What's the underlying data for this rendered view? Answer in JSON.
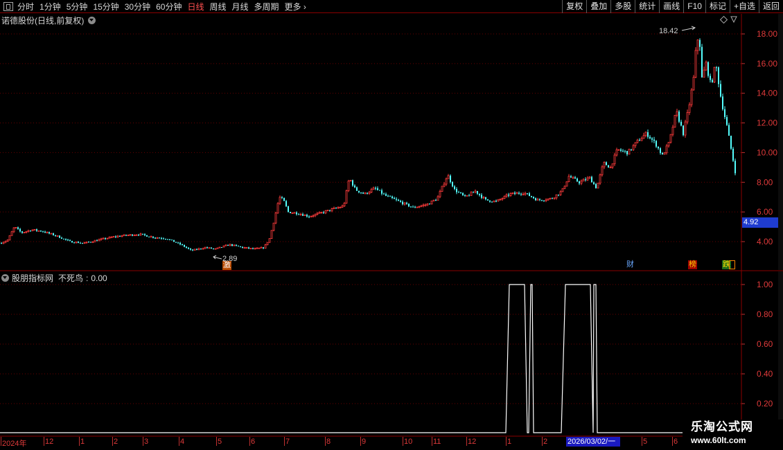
{
  "toolbar": {
    "periods": [
      "分时",
      "1分钟",
      "5分钟",
      "15分钟",
      "30分钟",
      "60分钟",
      "日线",
      "周线",
      "月线",
      "多周期",
      "更多"
    ],
    "active_period": "日线",
    "buttons": [
      "复权",
      "叠加",
      "多股",
      "统计",
      "画线",
      "F10",
      "标记",
      "+自选",
      "返回"
    ]
  },
  "main_chart": {
    "title": "诺德股份(日线,前复权)",
    "current_price": "4.92",
    "high_label": "18.42",
    "low_label": "2.89",
    "events": [
      "激",
      "财",
      "榜",
      "跌"
    ]
  },
  "indicator": {
    "title": "股朋指标网",
    "name": "不死鸟",
    "value": "0.00"
  },
  "x_axis": {
    "year_label": "2024年",
    "months": [
      "12",
      "1",
      "2",
      "3",
      "4",
      "5",
      "6",
      "7",
      "8",
      "9",
      "10",
      "11",
      "12",
      "1",
      "2",
      "5",
      "6"
    ],
    "cursor_date": "2026/03/02/一"
  },
  "watermark": {
    "title": "乐淘公式网",
    "url": "www.60lt.com"
  },
  "chart_data": [
    {
      "type": "candlestick",
      "title": "诺德股份(日线,前复权)",
      "y_ticks": [
        18.0,
        16.0,
        14.0,
        12.0,
        10.0,
        8.0,
        6.0,
        4.0
      ],
      "ylim": [
        2.5,
        19.2
      ],
      "grid": true,
      "x_month_labels": [
        "2024年",
        "12",
        "1",
        "2",
        "3",
        "4",
        "5",
        "6",
        "7",
        "8",
        "9",
        "10",
        "11",
        "12",
        "1",
        "2",
        "2026/03/02/一",
        "5",
        "6"
      ],
      "annotations": {
        "max": 18.42,
        "min": 2.89,
        "last": 4.92
      },
      "approx_close_path": [
        {
          "t": 0,
          "v": 3.9
        },
        {
          "t": 10,
          "v": 4.1
        },
        {
          "t": 20,
          "v": 5.0
        },
        {
          "t": 30,
          "v": 4.6
        },
        {
          "t": 45,
          "v": 4.8
        },
        {
          "t": 60,
          "v": 4.7
        },
        {
          "t": 80,
          "v": 4.4
        },
        {
          "t": 100,
          "v": 4.0
        },
        {
          "t": 120,
          "v": 3.9
        },
        {
          "t": 140,
          "v": 4.1
        },
        {
          "t": 160,
          "v": 4.3
        },
        {
          "t": 175,
          "v": 4.4
        },
        {
          "t": 200,
          "v": 4.5
        },
        {
          "t": 220,
          "v": 4.3
        },
        {
          "t": 240,
          "v": 4.2
        },
        {
          "t": 260,
          "v": 3.8
        },
        {
          "t": 275,
          "v": 3.4
        },
        {
          "t": 295,
          "v": 3.6
        },
        {
          "t": 310,
          "v": 3.5
        },
        {
          "t": 330,
          "v": 3.8
        },
        {
          "t": 350,
          "v": 3.6
        },
        {
          "t": 365,
          "v": 3.5
        },
        {
          "t": 380,
          "v": 3.6
        },
        {
          "t": 388,
          "v": 4.2
        },
        {
          "t": 395,
          "v": 5.5
        },
        {
          "t": 402,
          "v": 7.0
        },
        {
          "t": 408,
          "v": 6.8
        },
        {
          "t": 415,
          "v": 6.0
        },
        {
          "t": 430,
          "v": 5.9
        },
        {
          "t": 445,
          "v": 5.7
        },
        {
          "t": 460,
          "v": 5.9
        },
        {
          "t": 480,
          "v": 6.2
        },
        {
          "t": 495,
          "v": 6.4
        },
        {
          "t": 503,
          "v": 8.3
        },
        {
          "t": 512,
          "v": 7.5
        },
        {
          "t": 525,
          "v": 7.2
        },
        {
          "t": 540,
          "v": 7.6
        },
        {
          "t": 555,
          "v": 7.1
        },
        {
          "t": 575,
          "v": 6.7
        },
        {
          "t": 595,
          "v": 6.3
        },
        {
          "t": 615,
          "v": 6.5
        },
        {
          "t": 630,
          "v": 6.9
        },
        {
          "t": 645,
          "v": 8.5
        },
        {
          "t": 655,
          "v": 7.5
        },
        {
          "t": 670,
          "v": 7.0
        },
        {
          "t": 685,
          "v": 7.4
        },
        {
          "t": 700,
          "v": 6.8
        },
        {
          "t": 715,
          "v": 6.7
        },
        {
          "t": 735,
          "v": 7.2
        },
        {
          "t": 755,
          "v": 7.3
        },
        {
          "t": 775,
          "v": 6.8
        },
        {
          "t": 795,
          "v": 6.9
        },
        {
          "t": 810,
          "v": 7.4
        },
        {
          "t": 820,
          "v": 8.4
        },
        {
          "t": 835,
          "v": 8.0
        },
        {
          "t": 850,
          "v": 8.3
        },
        {
          "t": 860,
          "v": 7.6
        },
        {
          "t": 870,
          "v": 9.3
        },
        {
          "t": 880,
          "v": 9.0
        },
        {
          "t": 890,
          "v": 10.2
        },
        {
          "t": 905,
          "v": 10.0
        },
        {
          "t": 920,
          "v": 10.8
        },
        {
          "t": 932,
          "v": 11.3
        },
        {
          "t": 945,
          "v": 10.6
        },
        {
          "t": 955,
          "v": 9.8
        },
        {
          "t": 965,
          "v": 10.7
        },
        {
          "t": 975,
          "v": 12.8
        },
        {
          "t": 985,
          "v": 11.3
        },
        {
          "t": 993,
          "v": 13.0
        },
        {
          "t": 1000,
          "v": 15.0
        },
        {
          "t": 1004,
          "v": 17.3
        },
        {
          "t": 1008,
          "v": 18.0
        },
        {
          "t": 1012,
          "v": 15.0
        },
        {
          "t": 1018,
          "v": 16.0
        },
        {
          "t": 1025,
          "v": 14.5
        },
        {
          "t": 1032,
          "v": 16.0
        },
        {
          "t": 1040,
          "v": 13.5
        },
        {
          "t": 1048,
          "v": 11.8
        },
        {
          "t": 1055,
          "v": 10.0
        },
        {
          "t": 1062,
          "v": 8.2
        }
      ]
    },
    {
      "type": "line",
      "title": "不死鸟",
      "y_ticks": [
        1.0,
        0.8,
        0.6,
        0.4,
        0.2
      ],
      "ylim": [
        0.0,
        1.05
      ],
      "grid": true,
      "series": [
        {
          "name": "不死鸟",
          "points": [
            {
              "t": 0,
              "v": 0
            },
            {
              "t": 730,
              "v": 0
            },
            {
              "t": 735,
              "v": 1
            },
            {
              "t": 757,
              "v": 1
            },
            {
              "t": 761,
              "v": 0
            },
            {
              "t": 763,
              "v": 0
            },
            {
              "t": 766,
              "v": 1
            },
            {
              "t": 768,
              "v": 1
            },
            {
              "t": 770,
              "v": 0
            },
            {
              "t": 810,
              "v": 0
            },
            {
              "t": 816,
              "v": 1
            },
            {
              "t": 852,
              "v": 1
            },
            {
              "t": 856,
              "v": 0
            },
            {
              "t": 857,
              "v": 1
            },
            {
              "t": 860,
              "v": 1
            },
            {
              "t": 862,
              "v": 0
            },
            {
              "t": 1068,
              "v": 0
            }
          ]
        }
      ]
    }
  ]
}
